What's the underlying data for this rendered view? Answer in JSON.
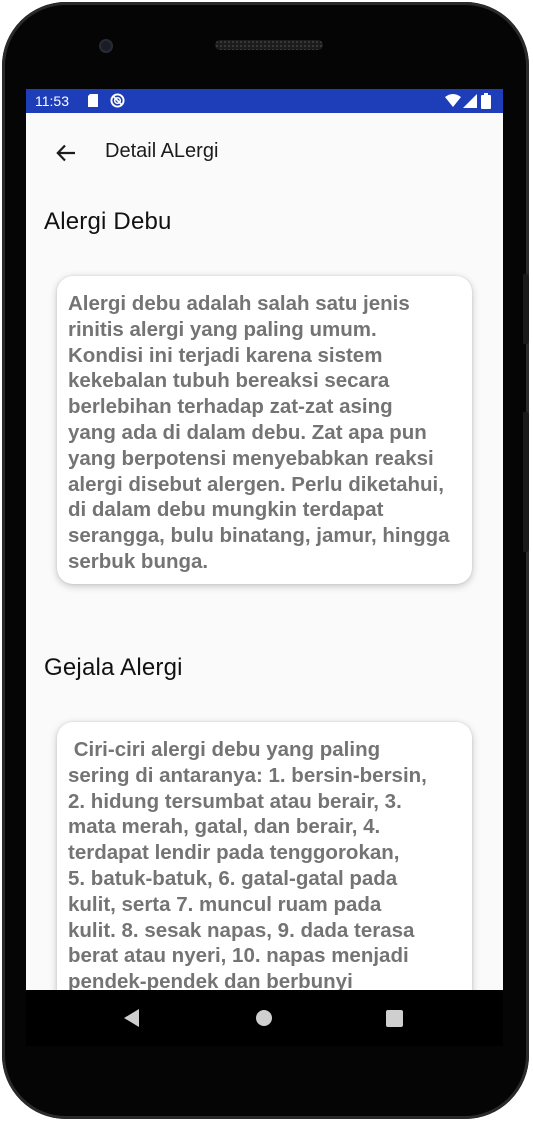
{
  "status_bar": {
    "time": "11:53",
    "background": "#1e3db8",
    "icons": [
      "sim-card-icon",
      "do-not-disturb-icon",
      "wifi-icon",
      "signal-icon",
      "battery-icon"
    ]
  },
  "toolbar": {
    "back_icon": "arrow-back-icon",
    "title": "Detail ALergi"
  },
  "sections": [
    {
      "title": "Alergi Debu",
      "body": "Alergi debu adalah salah satu jenis\nrinitis alergi yang paling umum.\nKondisi ini terjadi karena sistem\nkekebalan tubuh bereaksi secara\nberlebihan terhadap zat-zat asing\nyang ada di dalam debu. Zat apa pun\nyang berpotensi menyebabkan reaksi\nalergi disebut alergen. Perlu diketahui,\ndi dalam debu mungkin terdapat\nserangga, bulu binatang, jamur, hingga\nserbuk bunga."
    },
    {
      "title": "Gejala Alergi",
      "body": " Ciri-ciri alergi debu yang paling\nsering di antaranya: 1. bersin-bersin,\n2. hidung tersumbat atau berair, 3.\nmata merah, gatal, dan berair, 4.\nterdapat lendir pada tenggorokan,\n5. batuk-batuk, 6. gatal-gatal pada\nkulit, serta 7. muncul ruam pada\nkulit. 8. sesak napas, 9. dada terasa\nberat atau nyeri, 10. napas menjadi\npendek-pendek dan berbunyi"
    }
  ],
  "nav_bar": {
    "icons": [
      "back-triangle-icon",
      "home-circle-icon",
      "recents-square-icon"
    ]
  }
}
